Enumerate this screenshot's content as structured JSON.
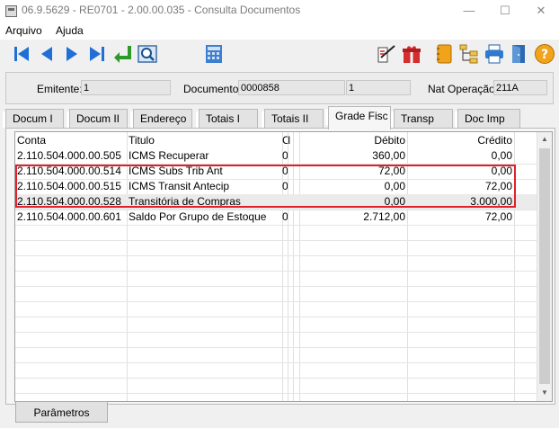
{
  "window": {
    "title": "06.9.5629 - RE0701 - 2.00.00.035 - Consulta Documentos",
    "minimize_glyph": "—",
    "maximize_glyph": "☐",
    "close_glyph": "✕"
  },
  "menu": {
    "file": "Arquivo",
    "help": "Ajuda"
  },
  "toolbar": {
    "icons": [
      "first-record-icon",
      "previous-record-icon",
      "next-record-icon",
      "last-record-icon",
      "return-icon",
      "zoom-icon",
      "calculator-icon",
      "edit-document-icon",
      "gift-box-icon",
      "notebook-icon",
      "tree-icon",
      "printer-icon",
      "exit-door-icon",
      "help-icon"
    ],
    "help_glyph": "?"
  },
  "header": {
    "emitente_label": "Emitente:",
    "emitente_value": "1",
    "documento_label": "Documento:",
    "documento_value": "0000858",
    "serie_value": "1",
    "natop_label": "Nat Operação:",
    "natop_value": "211A"
  },
  "tabs": [
    {
      "label": "Docum I"
    },
    {
      "label": "Docum II"
    },
    {
      "label": "Endereço"
    },
    {
      "label": "Totais I"
    },
    {
      "label": "Totais II"
    },
    {
      "label": "Grade Fisc",
      "active": true
    },
    {
      "label": "Transp"
    },
    {
      "label": "Doc Imp"
    }
  ],
  "grid": {
    "columns": {
      "conta": "Conta",
      "titulo": "Titulo",
      "c3": "C",
      "c4": "I",
      "debito": "Débito",
      "credito": "Crédito"
    },
    "rows": [
      {
        "conta": "2.110.504.000.00.505",
        "titulo": "ICMS Recuperar",
        "c3": "0",
        "debito": "360,00",
        "credito": "0,00"
      },
      {
        "conta": "2.110.504.000.00.514",
        "titulo": "ICMS Subs Trib Ant",
        "c3": "0",
        "debito": "72,00",
        "credito": "0,00"
      },
      {
        "conta": "2.110.504.000.00.515",
        "titulo": "ICMS Transit Antecip",
        "c3": "0",
        "debito": "0,00",
        "credito": "72,00"
      },
      {
        "conta": "2.110.504.000.00.528",
        "titulo": "Transitória de Compras",
        "c3": "",
        "debito": "0,00",
        "credito": "3.000,00"
      },
      {
        "conta": "2.110.504.000.00.601",
        "titulo": "Saldo Por Grupo de Estoque",
        "c3": "0",
        "debito": "2.712,00",
        "credito": "72,00"
      }
    ],
    "scroll_up": "▲",
    "scroll_down": "▼"
  },
  "footer": {
    "params_label": "Parâmetros"
  },
  "colors": {
    "highlight": "#e0202a",
    "nav_blue": "#1f6fd6",
    "return_green": "#2b9a2b"
  }
}
